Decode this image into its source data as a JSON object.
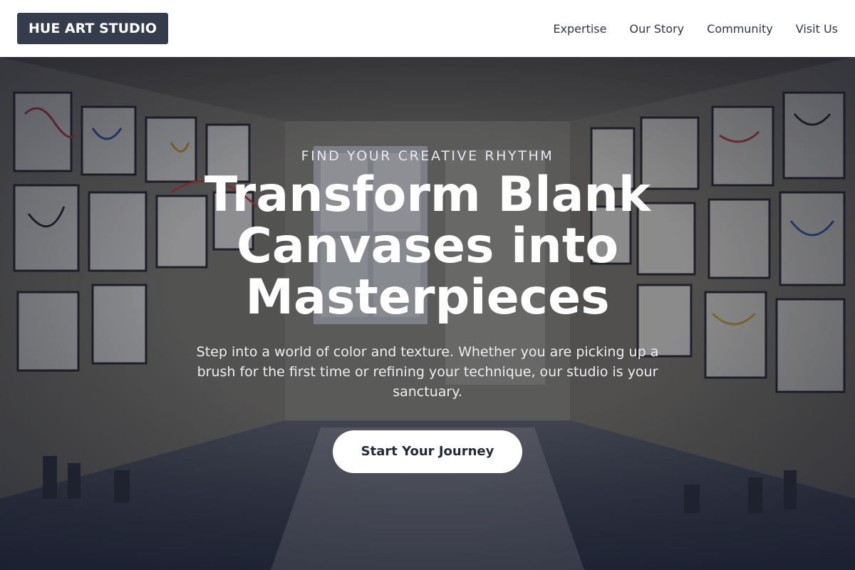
{
  "header": {
    "logo_text": "HUE ART STUDIO",
    "nav": [
      {
        "label": "Expertise"
      },
      {
        "label": "Our Story"
      },
      {
        "label": "Community"
      },
      {
        "label": "Visit Us"
      }
    ]
  },
  "hero": {
    "eyebrow": "FIND YOUR CREATIVE RHYTHM",
    "headline": "Transform Blank Canvases into Masterpieces",
    "subtext": "Step into a world of color and texture. Whether you are picking up a brush for the first time or refining your technique, our studio is your sanctuary.",
    "cta_label": "Start Your Journey",
    "background_image": "art-studio-interior-photo"
  },
  "colors": {
    "logo_bg": "#353c4c",
    "nav_text": "#2f3747",
    "hero_overlay": "#1e2436",
    "cta_bg": "#ffffff",
    "cta_text": "#232a3a"
  }
}
